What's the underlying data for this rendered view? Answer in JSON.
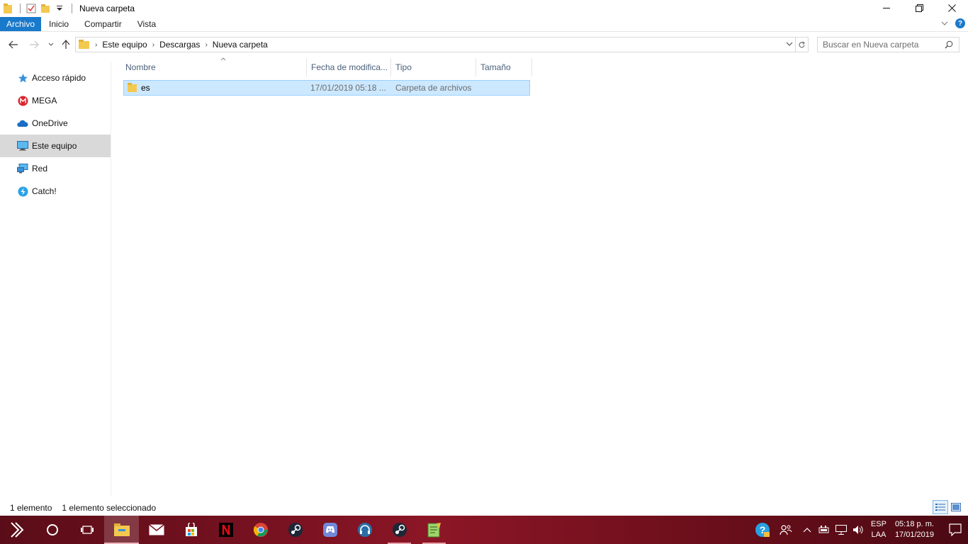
{
  "window": {
    "title": "Nueva carpeta",
    "controls": {
      "minimize": "—",
      "maximize": "❐",
      "close": "✕"
    }
  },
  "ribbon": {
    "tabs": [
      {
        "label": "Archivo"
      },
      {
        "label": "Inicio"
      },
      {
        "label": "Compartir"
      },
      {
        "label": "Vista"
      }
    ],
    "help": "?"
  },
  "address": {
    "breadcrumbs": [
      "Este equipo",
      "Descargas",
      "Nueva carpeta"
    ]
  },
  "search": {
    "placeholder": "Buscar en Nueva carpeta"
  },
  "sidebar": {
    "items": [
      {
        "label": "Acceso rápido",
        "icon": "star-icon"
      },
      {
        "label": "MEGA",
        "icon": "mega-icon"
      },
      {
        "label": "OneDrive",
        "icon": "cloud-icon"
      },
      {
        "label": "Este equipo",
        "icon": "computer-icon",
        "selected": true
      },
      {
        "label": "Red",
        "icon": "network-icon"
      },
      {
        "label": "Catch!",
        "icon": "catch-icon"
      }
    ]
  },
  "table": {
    "columns": [
      "Nombre",
      "Fecha de modifica...",
      "Tipo",
      "Tamaño"
    ],
    "rows": [
      {
        "name": "es",
        "date": "17/01/2019 05:18 ...",
        "type": "Carpeta de archivos",
        "size": ""
      }
    ]
  },
  "status": {
    "count": "1 elemento",
    "selection": "1 elemento seleccionado"
  },
  "taskbar": {
    "language": [
      "ESP",
      "LAA"
    ],
    "clock": {
      "time": "05:18 p. m.",
      "date": "17/01/2019"
    }
  },
  "colors": {
    "accent": "#1979ca",
    "selection": "#cce8ff",
    "folder": "#f4c94f",
    "taskbar": "#7a1221"
  }
}
